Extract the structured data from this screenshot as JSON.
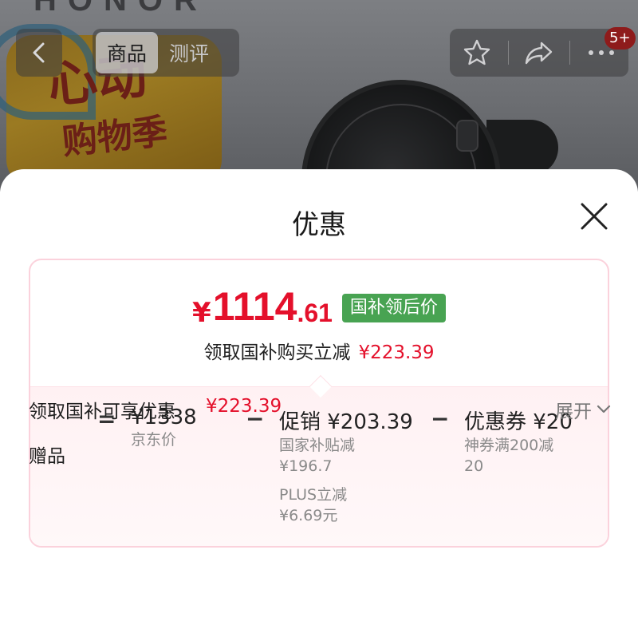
{
  "header": {
    "tabs": [
      {
        "label": "商品",
        "active": true
      },
      {
        "label": "测评",
        "active": false
      }
    ],
    "notification_badge": "5+",
    "icons": {
      "back": "back-arrow-icon",
      "favorite": "star-icon",
      "share": "share-icon",
      "more": "more-dots-icon"
    }
  },
  "hero": {
    "brand_text": "HONOR",
    "promo_line1": "心动",
    "promo_line2": "购物季"
  },
  "sheet": {
    "title": "优惠",
    "final_price": {
      "symbol": "¥",
      "integer": "1114",
      "decimal": ".61",
      "tag": "国补领后价"
    },
    "subsidy_line": {
      "label": "领取国补购买立减",
      "amount": "¥223.39"
    },
    "breakdown": {
      "equals": "=",
      "minus": "−",
      "base": {
        "amount": "¥1338",
        "label": "京东价"
      },
      "promotion": {
        "amount": "促销 ¥203.39",
        "items": [
          {
            "line1": "国家补贴减",
            "line2": "¥196.7"
          },
          {
            "line1": "PLUS立减",
            "line2": "¥6.69元"
          }
        ]
      },
      "coupon": {
        "amount": "优惠券 ¥20",
        "line1": "神券满200减",
        "line2": "20"
      }
    },
    "benefit": {
      "label": "领取国补可享优惠",
      "amount": "¥223.39",
      "expand": "展开"
    },
    "gift_label": "赠品"
  },
  "colors": {
    "accent_red": "#e4102b",
    "tag_green": "#48a352",
    "card_border": "#fbd2dc"
  }
}
